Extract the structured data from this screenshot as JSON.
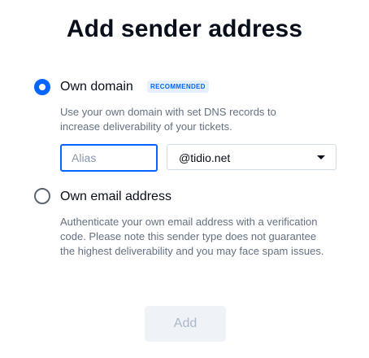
{
  "dialog": {
    "title": "Add sender address",
    "submit_label": "Add"
  },
  "options": {
    "own_domain": {
      "label": "Own domain",
      "badge": "RECOMMENDED",
      "selected": true,
      "description": "Use your own domain with set DNS records to increase deliverability of your tickets.",
      "alias_placeholder": "Alias",
      "alias_value": "",
      "domain_selected": "@tidio.net"
    },
    "own_email": {
      "label": "Own email address",
      "selected": false,
      "description": "Authenticate your own email address with a verification code. Please note this sender type does not guarantee the highest deliverability and you may face spam issues."
    }
  },
  "colors": {
    "accent": "#0566ff",
    "text": "#080f1a",
    "muted_text": "#647081",
    "disabled_button_bg": "#eff2f6"
  }
}
